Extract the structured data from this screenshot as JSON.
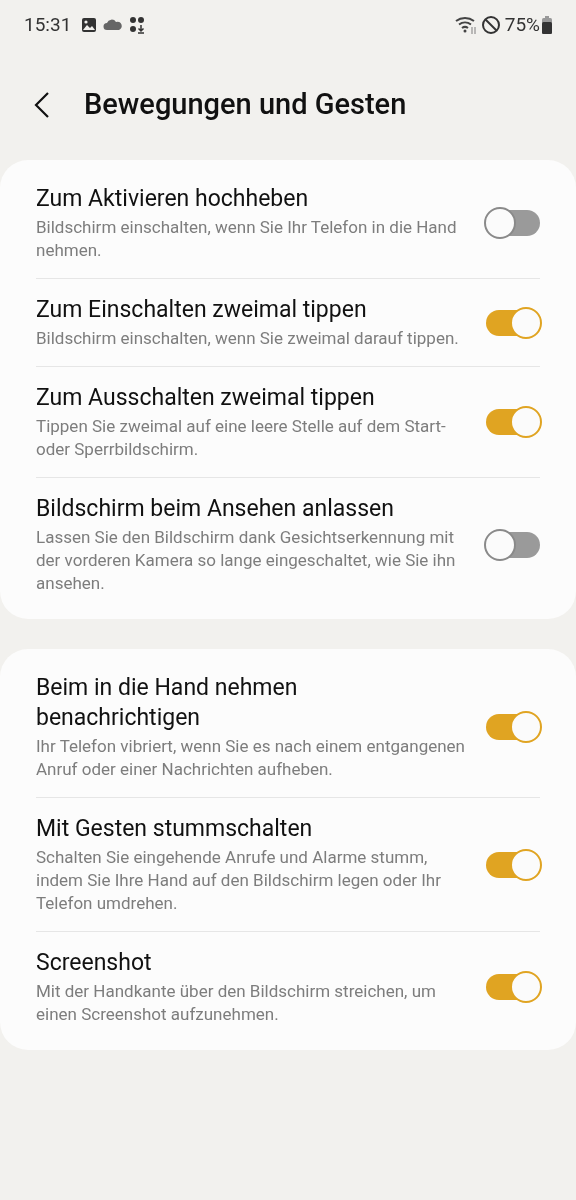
{
  "status_bar": {
    "time": "15:31",
    "battery": "75%"
  },
  "header": {
    "title": "Bewegungen und Gesten"
  },
  "groups": [
    {
      "items": [
        {
          "title": "Zum Aktivieren hochheben",
          "description": "Bildschirm einschalten, wenn Sie Ihr Telefon in die Hand nehmen.",
          "on": false
        },
        {
          "title": "Zum Einschalten zweimal tippen",
          "description": "Bildschirm einschalten, wenn Sie zweimal darauf tippen.",
          "on": true
        },
        {
          "title": "Zum Ausschalten zweimal tippen",
          "description": "Tippen Sie zweimal auf eine leere Stelle auf dem Start- oder Sperrbildschirm.",
          "on": true
        },
        {
          "title": "Bildschirm beim Ansehen anlassen",
          "description": "Lassen Sie den Bildschirm dank Gesichtserkennung mit der vorderen Kamera so lange eingeschaltet, wie Sie ihn ansehen.",
          "on": false
        }
      ]
    },
    {
      "items": [
        {
          "title": "Beim in die Hand nehmen benachrichtigen",
          "description": "Ihr Telefon vibriert, wenn Sie es nach einem entgangenen Anruf oder einer Nachrichten aufheben.",
          "on": true
        },
        {
          "title": "Mit Gesten stummschalten",
          "description": "Schalten Sie eingehende Anrufe und Alarme stumm, indem Sie Ihre Hand auf den Bildschirm legen oder Ihr Telefon umdrehen.",
          "on": true
        },
        {
          "title": "Screenshot",
          "description": "Mit der Handkante über den Bildschirm streichen, um einen Screenshot aufzunehmen.",
          "on": true
        }
      ]
    }
  ]
}
